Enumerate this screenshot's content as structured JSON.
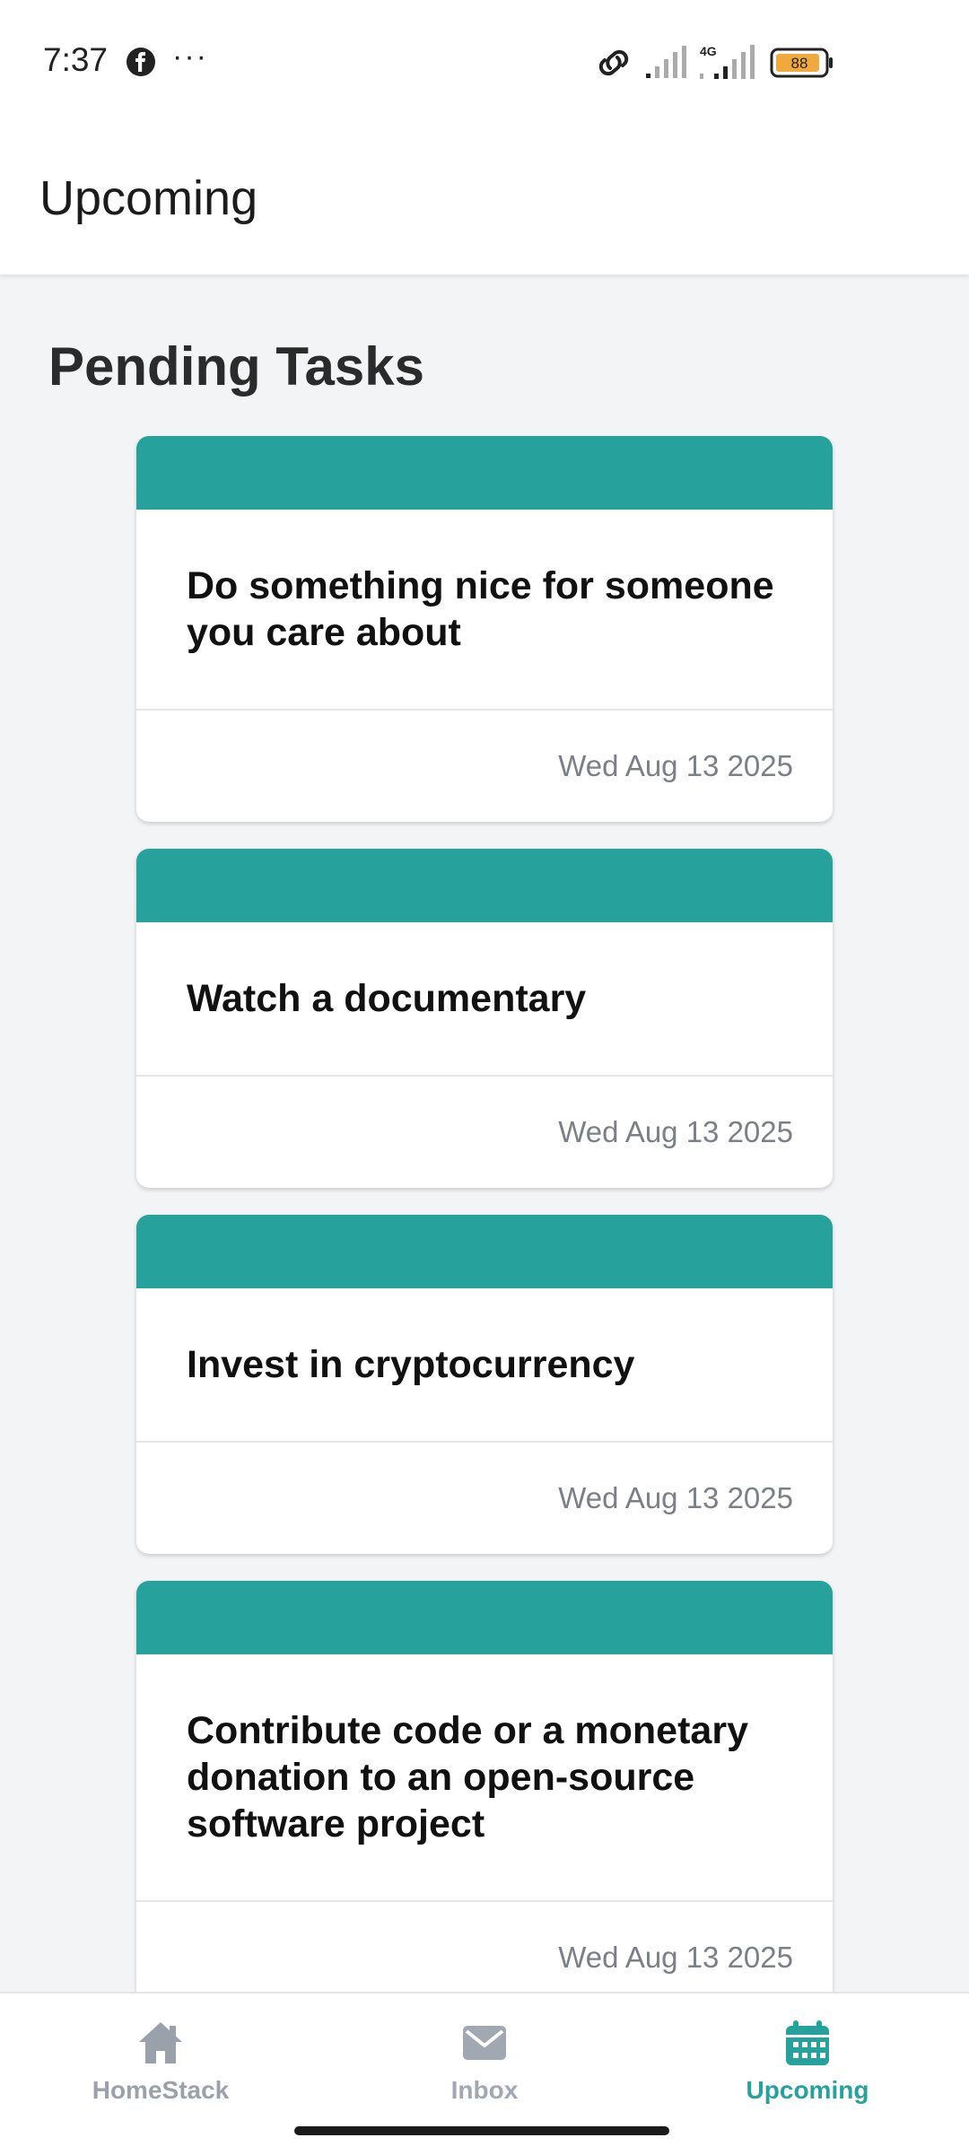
{
  "status_bar": {
    "time": "7:37",
    "network_label": "4G",
    "battery_level": "88"
  },
  "header": {
    "title": "Upcoming"
  },
  "section": {
    "title": "Pending Tasks"
  },
  "tasks": [
    {
      "title": "Do something nice for someone you care about",
      "date": "Wed Aug 13 2025"
    },
    {
      "title": "Watch a documentary",
      "date": "Wed Aug 13 2025"
    },
    {
      "title": "Invest in cryptocurrency",
      "date": "Wed Aug 13 2025"
    },
    {
      "title": "Contribute code or a monetary donation to an open-source software project",
      "date": "Wed Aug 13 2025"
    }
  ],
  "bottom_nav": {
    "items": [
      {
        "label": "HomeStack",
        "icon": "home-icon",
        "active": false
      },
      {
        "label": "Inbox",
        "icon": "mail-icon",
        "active": false
      },
      {
        "label": "Upcoming",
        "icon": "calendar-icon",
        "active": true
      }
    ]
  },
  "colors": {
    "accent": "#26a19b",
    "inactive": "#9aa1ab",
    "date_text": "#7a7f88"
  }
}
